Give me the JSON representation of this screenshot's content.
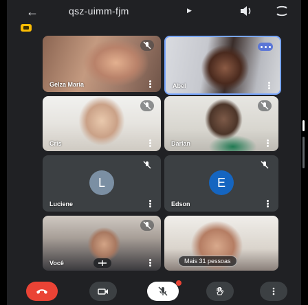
{
  "header": {
    "meeting_code": "qsz-uimm-fjm",
    "back_icon": "arrow-left-icon",
    "caret_icon": "caret-right-icon",
    "speaker_icon": "speaker-icon",
    "camera_switch_icon": "camera-switch-icon",
    "recording_icon": "recording-badge-icon"
  },
  "participants": [
    {
      "name": "Gelza Maria",
      "muted": true
    },
    {
      "name": "Abel",
      "muted": false,
      "speaking": true
    },
    {
      "name": "Cris",
      "muted": true
    },
    {
      "name": "Darlan",
      "muted": true
    },
    {
      "name": "Luciene",
      "muted": true,
      "initial": "L"
    },
    {
      "name": "Edson",
      "muted": true,
      "initial": "E"
    },
    {
      "name": "Você",
      "muted": true
    },
    {
      "name": "Mais 31 pessoas"
    }
  ],
  "colors": {
    "background": "#202124",
    "tile": "#3c4043",
    "end_call": "#ea4335",
    "speaking_border": "#7aa7ff",
    "avatar_l": "#7b8fa3",
    "avatar_e": "#1565c0",
    "recording": "#fbbc04"
  },
  "controls": {
    "end_call_icon": "phone-hangup-icon",
    "camera_icon": "video-camera-icon",
    "mic_icon": "mic-off-icon",
    "hand_icon": "raise-hand-icon",
    "more_icon": "more-vertical-icon"
  }
}
